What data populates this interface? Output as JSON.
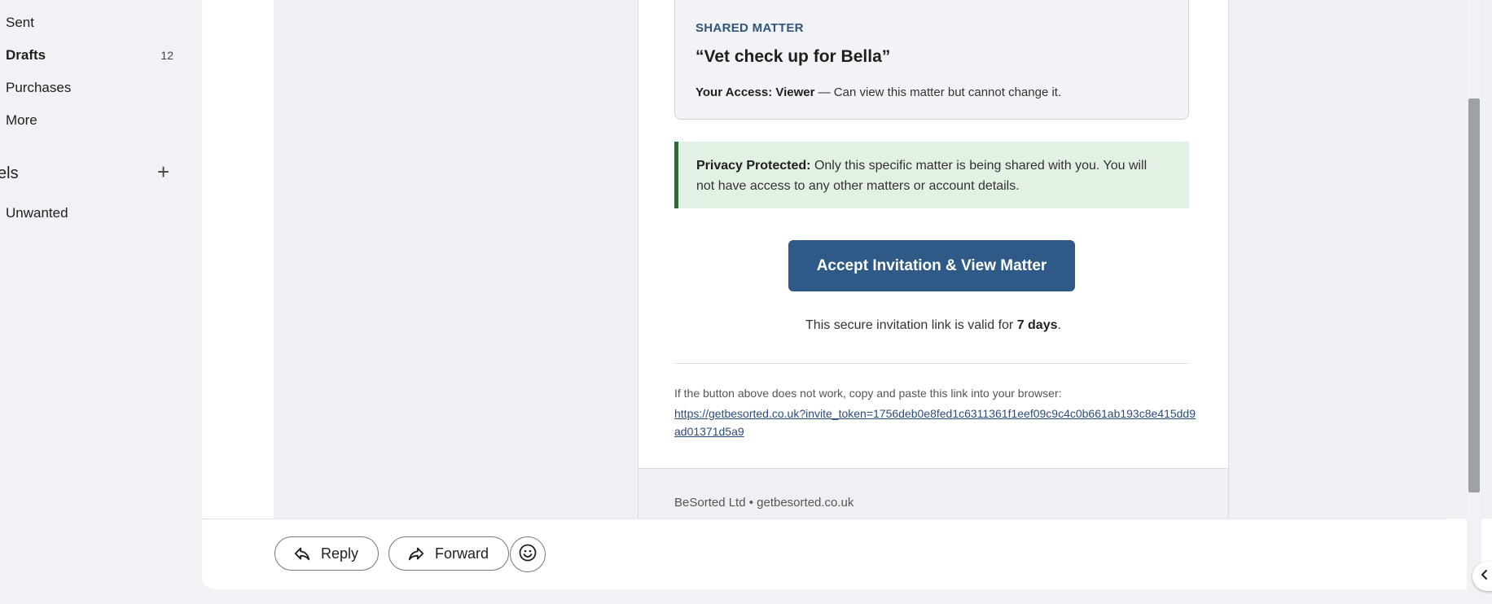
{
  "sidebar": {
    "items": [
      {
        "label": "Sent",
        "count": ""
      },
      {
        "label": "Drafts",
        "count": "12"
      },
      {
        "label": "Purchases",
        "count": ""
      },
      {
        "label": "More",
        "count": ""
      }
    ],
    "labels_heading": "els",
    "labels": [
      {
        "label": "Unwanted"
      }
    ]
  },
  "email": {
    "shared_tag": "SHARED MATTER",
    "matter_title": "“Vet check up for Bella”",
    "access_label": "Your Access: Viewer",
    "access_desc": " — Can view this matter but cannot change it.",
    "privacy_label": "Privacy Protected:",
    "privacy_text": " Only this specific matter is being shared with you. You will not have access to any other matters or account details.",
    "accept_button": "Accept Invitation & View Matter",
    "valid_prefix": "This secure invitation link is valid for ",
    "valid_days": "7 days",
    "valid_suffix": ".",
    "fallback_text": "If the button above does not work, copy and paste this link into your browser:",
    "invite_link": "https://getbesorted.co.uk?invite_token=1756deb0e8fed1c6311361f1eef09c9c4c0b661ab193c8e415dd9ad01371d5a9",
    "footer": "BeSorted Ltd • getbesorted.co.uk"
  },
  "actions": {
    "reply": "Reply",
    "forward": "Forward"
  },
  "icons": {
    "add": "plus-icon",
    "reply": "reply-icon",
    "forward": "forward-icon",
    "emoji": "smiley-icon",
    "toggle": "chevron-left-icon"
  },
  "colors": {
    "accent": "#2f5a87",
    "privacy_bar": "#2f6b3a",
    "privacy_bg": "#e3f1e4",
    "tag": "#34557a"
  }
}
